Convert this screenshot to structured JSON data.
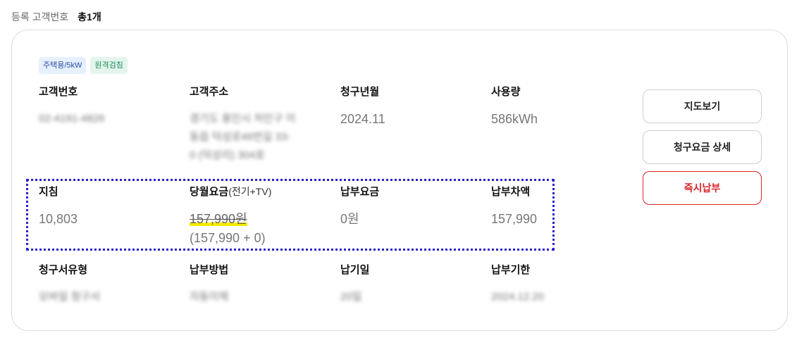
{
  "summary": {
    "label": "등록 고객번호",
    "count": "총1개"
  },
  "tags": {
    "type": "주택용/5kW",
    "method": "원격검침"
  },
  "row1": {
    "customer_no_label": "고객번호",
    "customer_no_value": "02-4191-4826",
    "address_label": "고객주소",
    "address_line1": "경기도 용인시 처인구 이",
    "address_line2": "동읍 덕성로46번길 33-",
    "address_line3": "0 (덕성리) 304호",
    "billing_month_label": "청구년월",
    "billing_month_value": "2024.11",
    "usage_label": "사용량",
    "usage_value": "586kWh"
  },
  "row2": {
    "reading_label": "지침",
    "reading_value": "10,803",
    "monthly_fee_label": "당월요금",
    "monthly_fee_sub": "(전기+TV)",
    "monthly_fee_value": "157,990원",
    "monthly_fee_breakdown": "(157,990 + 0)",
    "paid_label": "납부요금",
    "paid_value": "0원",
    "diff_label": "납부차액",
    "diff_value": "157,990"
  },
  "row3": {
    "bill_type_label": "청구서유형",
    "bill_type_value": "모바일 청구서",
    "pay_method_label": "납부방법",
    "pay_method_value": "자동이체",
    "due_day_label": "납기일",
    "due_day_value": "20일",
    "due_date_label": "납부기한",
    "due_date_value": "2024.12.20"
  },
  "buttons": {
    "map": "지도보기",
    "detail": "청구요금 상세",
    "pay_now": "즉시납부"
  },
  "colors": {
    "accent_red": "#d9252b",
    "dotted_box": "#2a21c9",
    "highlight": "#f5ec00"
  }
}
